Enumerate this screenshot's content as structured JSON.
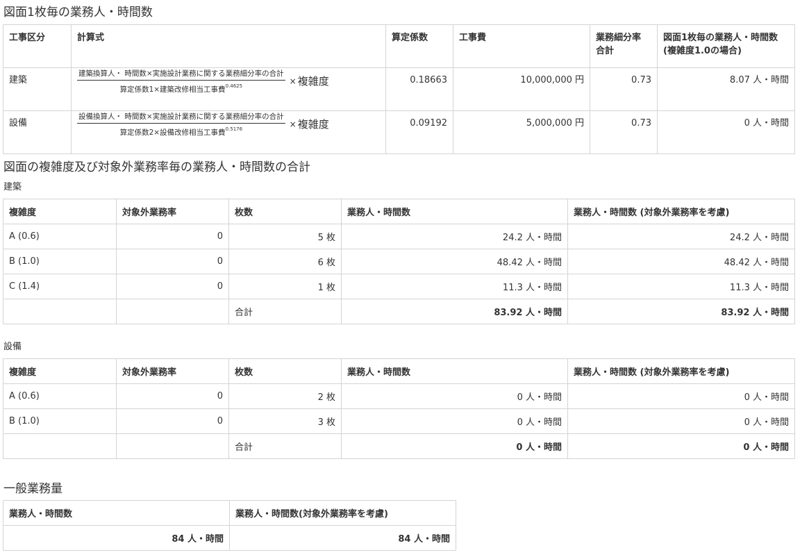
{
  "section1": {
    "title": "図面1枚毎の業務人・時間数",
    "headers": [
      "工事区分",
      "計算式",
      "算定係数",
      "工事費",
      "業務細分率\n合計",
      "図面1枚毎の業務人・時間数\n(複雑度1.0の場合)"
    ],
    "times_symbol": "×",
    "complexity_word": "複雑度",
    "rows": [
      {
        "category": "建築",
        "numerator": "建築換算人・ 時間数×実施設計業務に関する業務細分率の合計",
        "denominator": "算定係数1×建築改修相当工事費",
        "exponent": "0.4625",
        "coefficient": "0.18663",
        "cost": "10,000,000 円",
        "rate": "0.73",
        "hours": "8.07 人・時間"
      },
      {
        "category": "設備",
        "numerator": "設備換算人・ 時間数×実施設計業務に関する業務細分率の合計",
        "denominator": "算定係数2×設備改修相当工事費",
        "exponent": "0.5176",
        "coefficient": "0.09192",
        "cost": "5,000,000 円",
        "rate": "0.73",
        "hours": "0 人・時間"
      }
    ]
  },
  "section2": {
    "title": "図面の複雑度及び対象外業務率毎の業務人・時間数の合計",
    "headers": [
      "複雑度",
      "対象外業務率",
      "枚数",
      "業務人・時間数",
      "業務人・時間数 (対象外業務率を考慮)"
    ],
    "total_label": "合計",
    "kenchiku": {
      "label": "建築",
      "rows": [
        {
          "complexity": "A (0.6)",
          "excluded_rate": "0",
          "sheets": "5 枚",
          "hours": "24.2 人・時間",
          "hours_adj": "24.2 人・時間"
        },
        {
          "complexity": "B (1.0)",
          "excluded_rate": "0",
          "sheets": "6 枚",
          "hours": "48.42 人・時間",
          "hours_adj": "48.42 人・時間"
        },
        {
          "complexity": "C (1.4)",
          "excluded_rate": "0",
          "sheets": "1 枚",
          "hours": "11.3 人・時間",
          "hours_adj": "11.3 人・時間"
        }
      ],
      "total_hours": "83.92 人・時間",
      "total_hours_adj": "83.92 人・時間"
    },
    "setsubi": {
      "label": "設備",
      "rows": [
        {
          "complexity": "A (0.6)",
          "excluded_rate": "0",
          "sheets": "2 枚",
          "hours": "0 人・時間",
          "hours_adj": "0 人・時間"
        },
        {
          "complexity": "B (1.0)",
          "excluded_rate": "0",
          "sheets": "3 枚",
          "hours": "0 人・時間",
          "hours_adj": "0 人・時間"
        }
      ],
      "total_hours": "0 人・時間",
      "total_hours_adj": "0 人・時間"
    }
  },
  "section3": {
    "title": "一般業務量",
    "headers": [
      "業務人・時間数",
      "業務人・時間数(対象外業務率を考慮)"
    ],
    "hours": "84 人・時間",
    "hours_adj": "84 人・時間"
  }
}
